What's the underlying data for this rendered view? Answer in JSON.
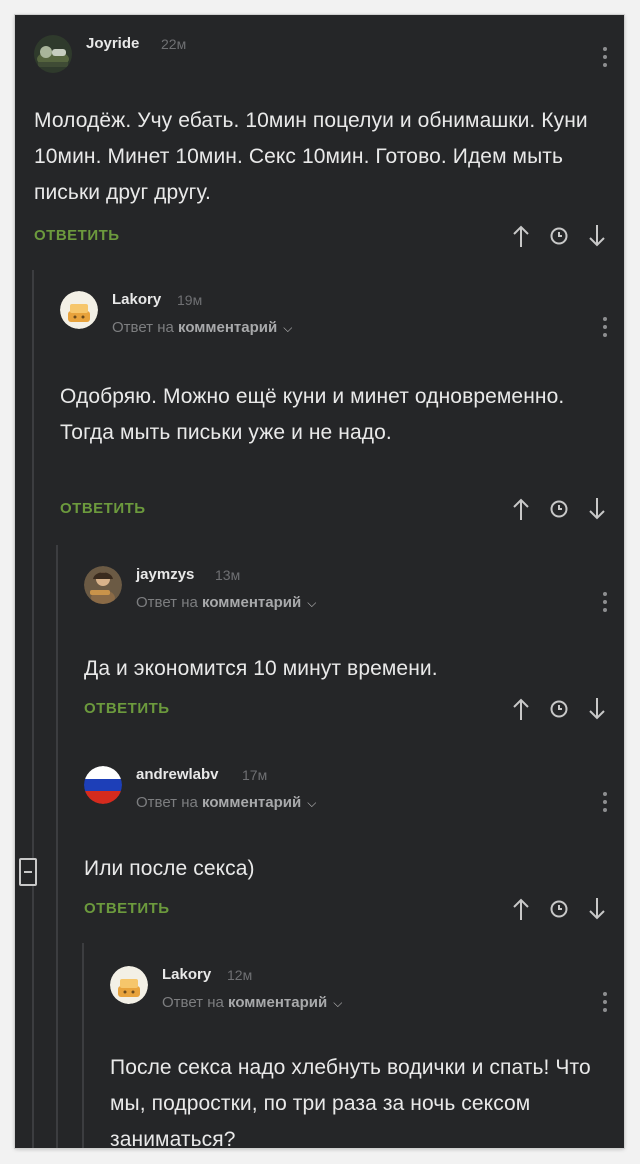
{
  "comments": [
    {
      "user": "Joyride",
      "time": "22м",
      "reply_prefix": "",
      "reply_target": "",
      "text": "Молодёж. Учу ебать. 10мин поцелуи и обнимашки. Куни 10мин. Минет 10мин. Секс 10мин. Готово. Идем мыть письки друг другу.",
      "reply_label": "ОТВЕТИТЬ"
    },
    {
      "user": "Lakory",
      "time": "19м",
      "reply_prefix": "Ответ на",
      "reply_target": "комментарий",
      "text": "Одобряю. Можно ещё куни и минет одновременно. Тогда мыть письки уже и не надо.",
      "reply_label": "ОТВЕТИТЬ"
    },
    {
      "user": "jaymzys",
      "time": "13м",
      "reply_prefix": "Ответ на",
      "reply_target": "комментарий",
      "text": "Да и экономится 10 минут времени.",
      "reply_label": "ОТВЕТИТЬ"
    },
    {
      "user": "andrewlabv",
      "time": "17м",
      "reply_prefix": "Ответ на",
      "reply_target": "комментарий",
      "text": "Или после секса)",
      "reply_label": "ОТВЕТИТЬ"
    },
    {
      "user": "Lakory",
      "time": "12м",
      "reply_prefix": "Ответ на",
      "reply_target": "комментарий",
      "text": "После секса надо хлебнуть водички и спать! Что мы, подростки, по три раза за ночь сексом заниматься?",
      "reply_label": ""
    }
  ],
  "colors": {
    "background": "#252628",
    "reply_button": "#6c9a3d",
    "text": "#e9e9e9",
    "muted": "#7d7e80"
  },
  "icons": [
    "more-vertical-icon",
    "arrow-up-icon",
    "clock-icon",
    "arrow-down-icon",
    "chevron-down-icon",
    "collapse-icon"
  ]
}
